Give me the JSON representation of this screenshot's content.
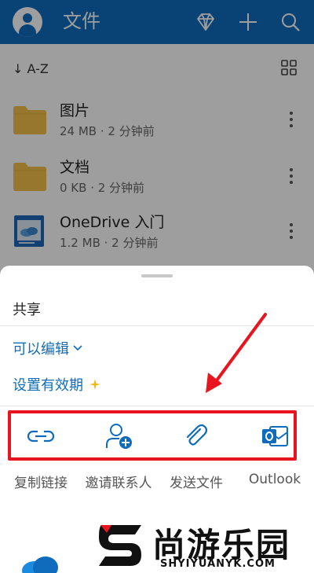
{
  "app": {
    "title": "文件",
    "sort_label": "↓ A-Z"
  },
  "files": [
    {
      "name": "图片",
      "meta": "24 MB · 2 分钟前",
      "type": "folder"
    },
    {
      "name": "文档",
      "meta": "0 KB · 2 分钟前",
      "type": "folder"
    },
    {
      "name": "OneDrive 入门",
      "meta": "1.2 MB · 2 分钟前",
      "type": "document"
    }
  ],
  "share_sheet": {
    "title": "共享",
    "permission": "可以编辑",
    "expiry": "设置有效期",
    "actions": [
      {
        "label": "复制链接",
        "icon": "link-icon"
      },
      {
        "label": "邀请联系人",
        "icon": "add-contact-icon"
      },
      {
        "label": "发送文件",
        "icon": "paperclip-icon"
      },
      {
        "label": "Outlook",
        "icon": "outlook-icon"
      }
    ]
  },
  "watermark": {
    "text": "尚游乐园",
    "sub": "SHYIYUANYK.COM"
  },
  "colors": {
    "brand": "#0f6cbd",
    "folder": "#f2c04a",
    "annotation": "#e8141f"
  }
}
